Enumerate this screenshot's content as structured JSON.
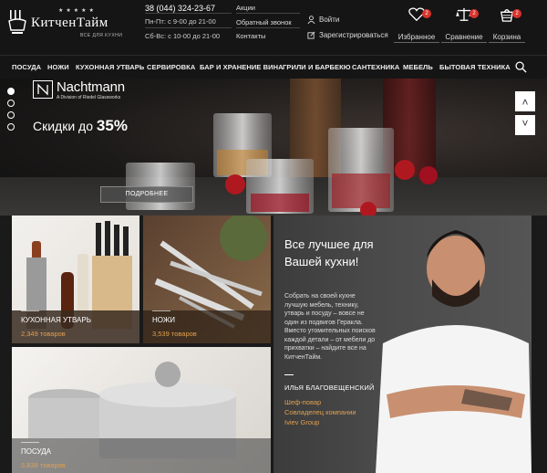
{
  "header": {
    "logo": {
      "stars": "★★★★★",
      "name": "КитченТайм",
      "tagline": "ВСЕ ДЛЯ КУХНИ"
    },
    "phone": "38 (044) 324-23-67",
    "hours_weekday": "Пн-Пт: с 9-00 до 21-00",
    "hours_weekend": "Сб-Вс: с 10-00 до 21-00",
    "links": [
      "Акции",
      "Обратный звонок",
      "Контакты"
    ],
    "login": "Войти",
    "register": "Зарегистрироваться",
    "tools": [
      {
        "label": "Избранное",
        "count": "2",
        "icon": "heart-icon"
      },
      {
        "label": "Сравнение",
        "count": "2",
        "icon": "scales-icon"
      },
      {
        "label": "Корзина",
        "count": "2",
        "icon": "basket-icon"
      }
    ]
  },
  "nav": {
    "items": [
      "ПОСУДА",
      "НОЖИ",
      "КУХОННАЯ УТВАРЬ",
      "СЕРВИРОВКА",
      "БАР И ХРАНЕНИЕ ВИНА",
      "ГРИЛИ И БАРБЕКЮ",
      "САНТЕХНИКА",
      "МЕБЕЛЬ",
      "БЫТОВАЯ ТЕХНИКА"
    ],
    "search_icon": "search-icon"
  },
  "hero": {
    "brand_name": "Nachtmann",
    "brand_sub": "A Division of Riedel Glassworks",
    "promo_text": "Скидки до ",
    "promo_value": "35%",
    "more_button": "ПОДРОБНЕЕ",
    "up_arrow": "˄",
    "down_arrow": "˅"
  },
  "categories": [
    {
      "label": "КУХОННАЯ УТВАРЬ",
      "count": "2,349 товаров"
    },
    {
      "label": "НОЖИ",
      "count": "3,539 товаров"
    },
    {
      "label": "ПОСУДА",
      "count": "5,838 товаров"
    }
  ],
  "promo_panel": {
    "title": "Все лучшее для Вашей кухни!",
    "text": "Собрать на своей кухне лучшую мебель, технику, утварь и посуду – вовсе не один из подвигов Геракла. Вместо утомительных поисков каждой детали – от мебели до прихватки – найдите все на КитченТайм.",
    "person_name": "ИЛЬЯ БЛАГОВЕЩЕНСКИЙ",
    "roles": [
      "Шеф-повар",
      "Совладелец компании",
      "Iviev Group"
    ]
  }
}
